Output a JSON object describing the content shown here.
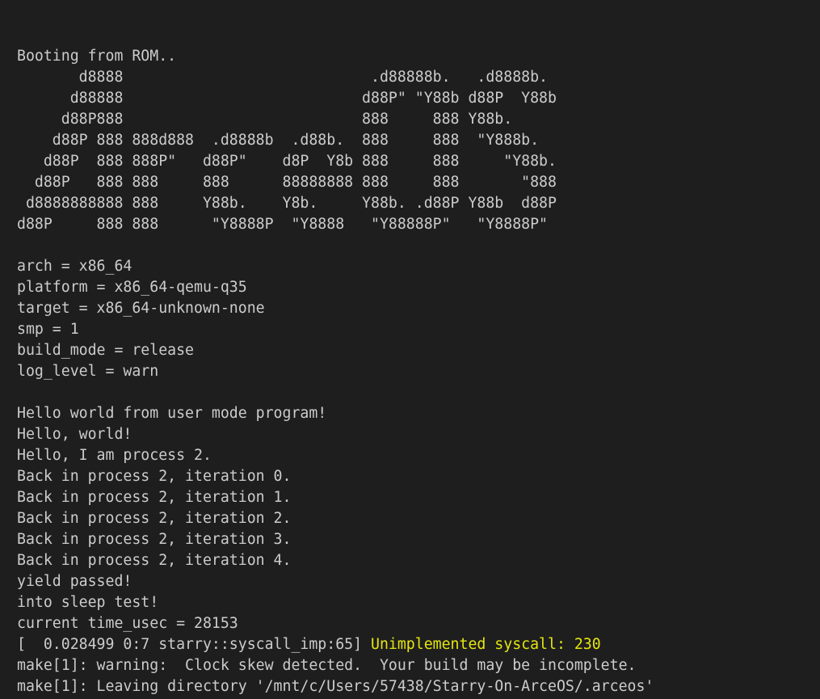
{
  "terminal": {
    "colors": {
      "background": "#1e1e1e",
      "foreground": "#cccccc",
      "warning": "#e5e510"
    },
    "lines": [
      {
        "segments": [
          {
            "text": "Booting from ROM.."
          }
        ]
      },
      {
        "segments": [
          {
            "text": "       d8888                            .d88888b.   .d8888b."
          }
        ]
      },
      {
        "segments": [
          {
            "text": "      d88888                           d88P\" \"Y88b d88P  Y88b"
          }
        ]
      },
      {
        "segments": [
          {
            "text": "     d88P888                           888     888 Y88b."
          }
        ]
      },
      {
        "segments": [
          {
            "text": "    d88P 888 888d888  .d8888b  .d88b.  888     888  \"Y888b."
          }
        ]
      },
      {
        "segments": [
          {
            "text": "   d88P  888 888P\"   d88P\"    d8P  Y8b 888     888     \"Y88b."
          }
        ]
      },
      {
        "segments": [
          {
            "text": "  d88P   888 888     888      88888888 888     888       \"888"
          }
        ]
      },
      {
        "segments": [
          {
            "text": " d8888888888 888     Y88b.    Y8b.     Y88b. .d88P Y88b  d88P"
          }
        ]
      },
      {
        "segments": [
          {
            "text": "d88P     888 888      \"Y8888P  \"Y8888   \"Y88888P\"   \"Y8888P\""
          }
        ]
      },
      {
        "segments": [
          {
            "text": ""
          }
        ]
      },
      {
        "segments": [
          {
            "text": "arch = x86_64"
          }
        ]
      },
      {
        "segments": [
          {
            "text": "platform = x86_64-qemu-q35"
          }
        ]
      },
      {
        "segments": [
          {
            "text": "target = x86_64-unknown-none"
          }
        ]
      },
      {
        "segments": [
          {
            "text": "smp = 1"
          }
        ]
      },
      {
        "segments": [
          {
            "text": "build_mode = release"
          }
        ]
      },
      {
        "segments": [
          {
            "text": "log_level = warn"
          }
        ]
      },
      {
        "segments": [
          {
            "text": ""
          }
        ]
      },
      {
        "segments": [
          {
            "text": "Hello world from user mode program!"
          }
        ]
      },
      {
        "segments": [
          {
            "text": "Hello, world!"
          }
        ]
      },
      {
        "segments": [
          {
            "text": "Hello, I am process 2."
          }
        ]
      },
      {
        "segments": [
          {
            "text": "Back in process 2, iteration 0."
          }
        ]
      },
      {
        "segments": [
          {
            "text": "Back in process 2, iteration 1."
          }
        ]
      },
      {
        "segments": [
          {
            "text": "Back in process 2, iteration 2."
          }
        ]
      },
      {
        "segments": [
          {
            "text": "Back in process 2, iteration 3."
          }
        ]
      },
      {
        "segments": [
          {
            "text": "Back in process 2, iteration 4."
          }
        ]
      },
      {
        "segments": [
          {
            "text": "yield passed!"
          }
        ]
      },
      {
        "segments": [
          {
            "text": "into sleep test!"
          }
        ]
      },
      {
        "segments": [
          {
            "text": "current time_usec = 28153"
          }
        ]
      },
      {
        "segments": [
          {
            "text": "[  0.028499 0:7 starry::syscall_imp:65] "
          },
          {
            "text": "Unimplemented syscall: 230",
            "color": "warning"
          }
        ]
      },
      {
        "segments": [
          {
            "text": "make[1]: warning:  Clock skew detected.  Your build may be incomplete."
          }
        ]
      },
      {
        "segments": [
          {
            "text": "make[1]: Leaving directory '/mnt/c/Users/57438/Starry-On-ArceOS/.arceos'"
          }
        ]
      }
    ]
  }
}
